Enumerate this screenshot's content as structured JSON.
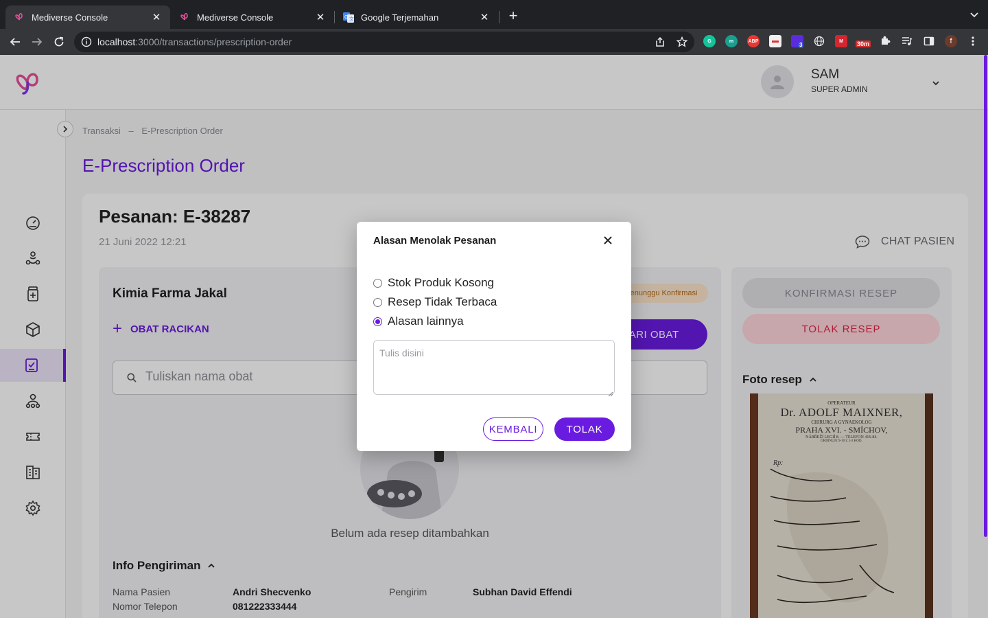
{
  "browser": {
    "tabs": [
      {
        "title": "Mediverse Console",
        "active": true
      },
      {
        "title": "Mediverse Console",
        "active": false
      },
      {
        "title": "Google Terjemahan",
        "active": false
      }
    ],
    "url_host": "localhost",
    "url_path": ":3000/transactions/prescription-order",
    "extension_badges": {
      "badge_count": "3",
      "timer": "30m",
      "profile_initial": "f"
    }
  },
  "header": {
    "user_name": "SAM",
    "user_role": "SUPER ADMIN"
  },
  "sidebar": {
    "items": [
      {
        "icon": "dashboard-icon"
      },
      {
        "icon": "network-icon"
      },
      {
        "icon": "medicine-bottle-icon"
      },
      {
        "icon": "package-icon"
      },
      {
        "icon": "prescription-icon",
        "active": true
      },
      {
        "icon": "users-icon"
      },
      {
        "icon": "ticket-icon"
      },
      {
        "icon": "report-icon"
      },
      {
        "icon": "settings-icon"
      }
    ]
  },
  "breadcrumb": {
    "parent": "Transaksi",
    "separator": "–",
    "current": "E-Prescription Order"
  },
  "page": {
    "title": "E-Prescription Order"
  },
  "order": {
    "title": "Pesanan: E-38287",
    "date": "21 Juni 2022 12:21",
    "chat_label": "CHAT PASIEN",
    "pharmacy": "Kimia Farma Jakal",
    "status": "Menunggu Konfirmasi",
    "racikan_label": "OBAT RACIKAN",
    "cari_obat_label": "CARI OBAT",
    "search_placeholder": "Tuliskan nama obat",
    "empty_text": "Belum ada resep ditambahkan",
    "shipping_title": "Info Pengiriman",
    "shipping": {
      "nama_pasien_label": "Nama Pasien",
      "nama_pasien": "Andri Shecvenko",
      "telepon_label": "Nomor Telepon",
      "telepon": "081222333444",
      "pengirim_label": "Pengirim",
      "pengirim": "Subhan David Effendi"
    }
  },
  "actions": {
    "konfirmasi_label": "KONFIRMASI RESEP",
    "tolak_label": "TOLAK RESEP",
    "foto_title": "Foto resep"
  },
  "prescription_photo": {
    "line1": "OPERATEUR",
    "line2": "Dr. ADOLF MAIXNER,",
    "line3": "CHIRURG A GYNAEKOLOG",
    "line4": "PRAHA XVI. - SMÍCHOV,",
    "line5": "NÁBŘEŽÍ LEGIÍ 8. — TELEFON 416-84.",
    "line6": "ORDINUJE 9-10 Z 2-3 HOD.",
    "rp": "Rp:"
  },
  "modal": {
    "title": "Alasan Menolak Pesanan",
    "options": [
      {
        "label": "Stok Produk Kosong",
        "checked": false
      },
      {
        "label": "Resep Tidak Terbaca",
        "checked": false
      },
      {
        "label": "Alasan lainnya",
        "checked": true
      }
    ],
    "textarea_placeholder": "Tulis disini",
    "textarea_value": "",
    "back_label": "KEMBALI",
    "reject_label": "TOLAK"
  },
  "colors": {
    "primary": "#6a1be0",
    "danger": "#e0254a",
    "warning_bg": "#fde6cc"
  }
}
